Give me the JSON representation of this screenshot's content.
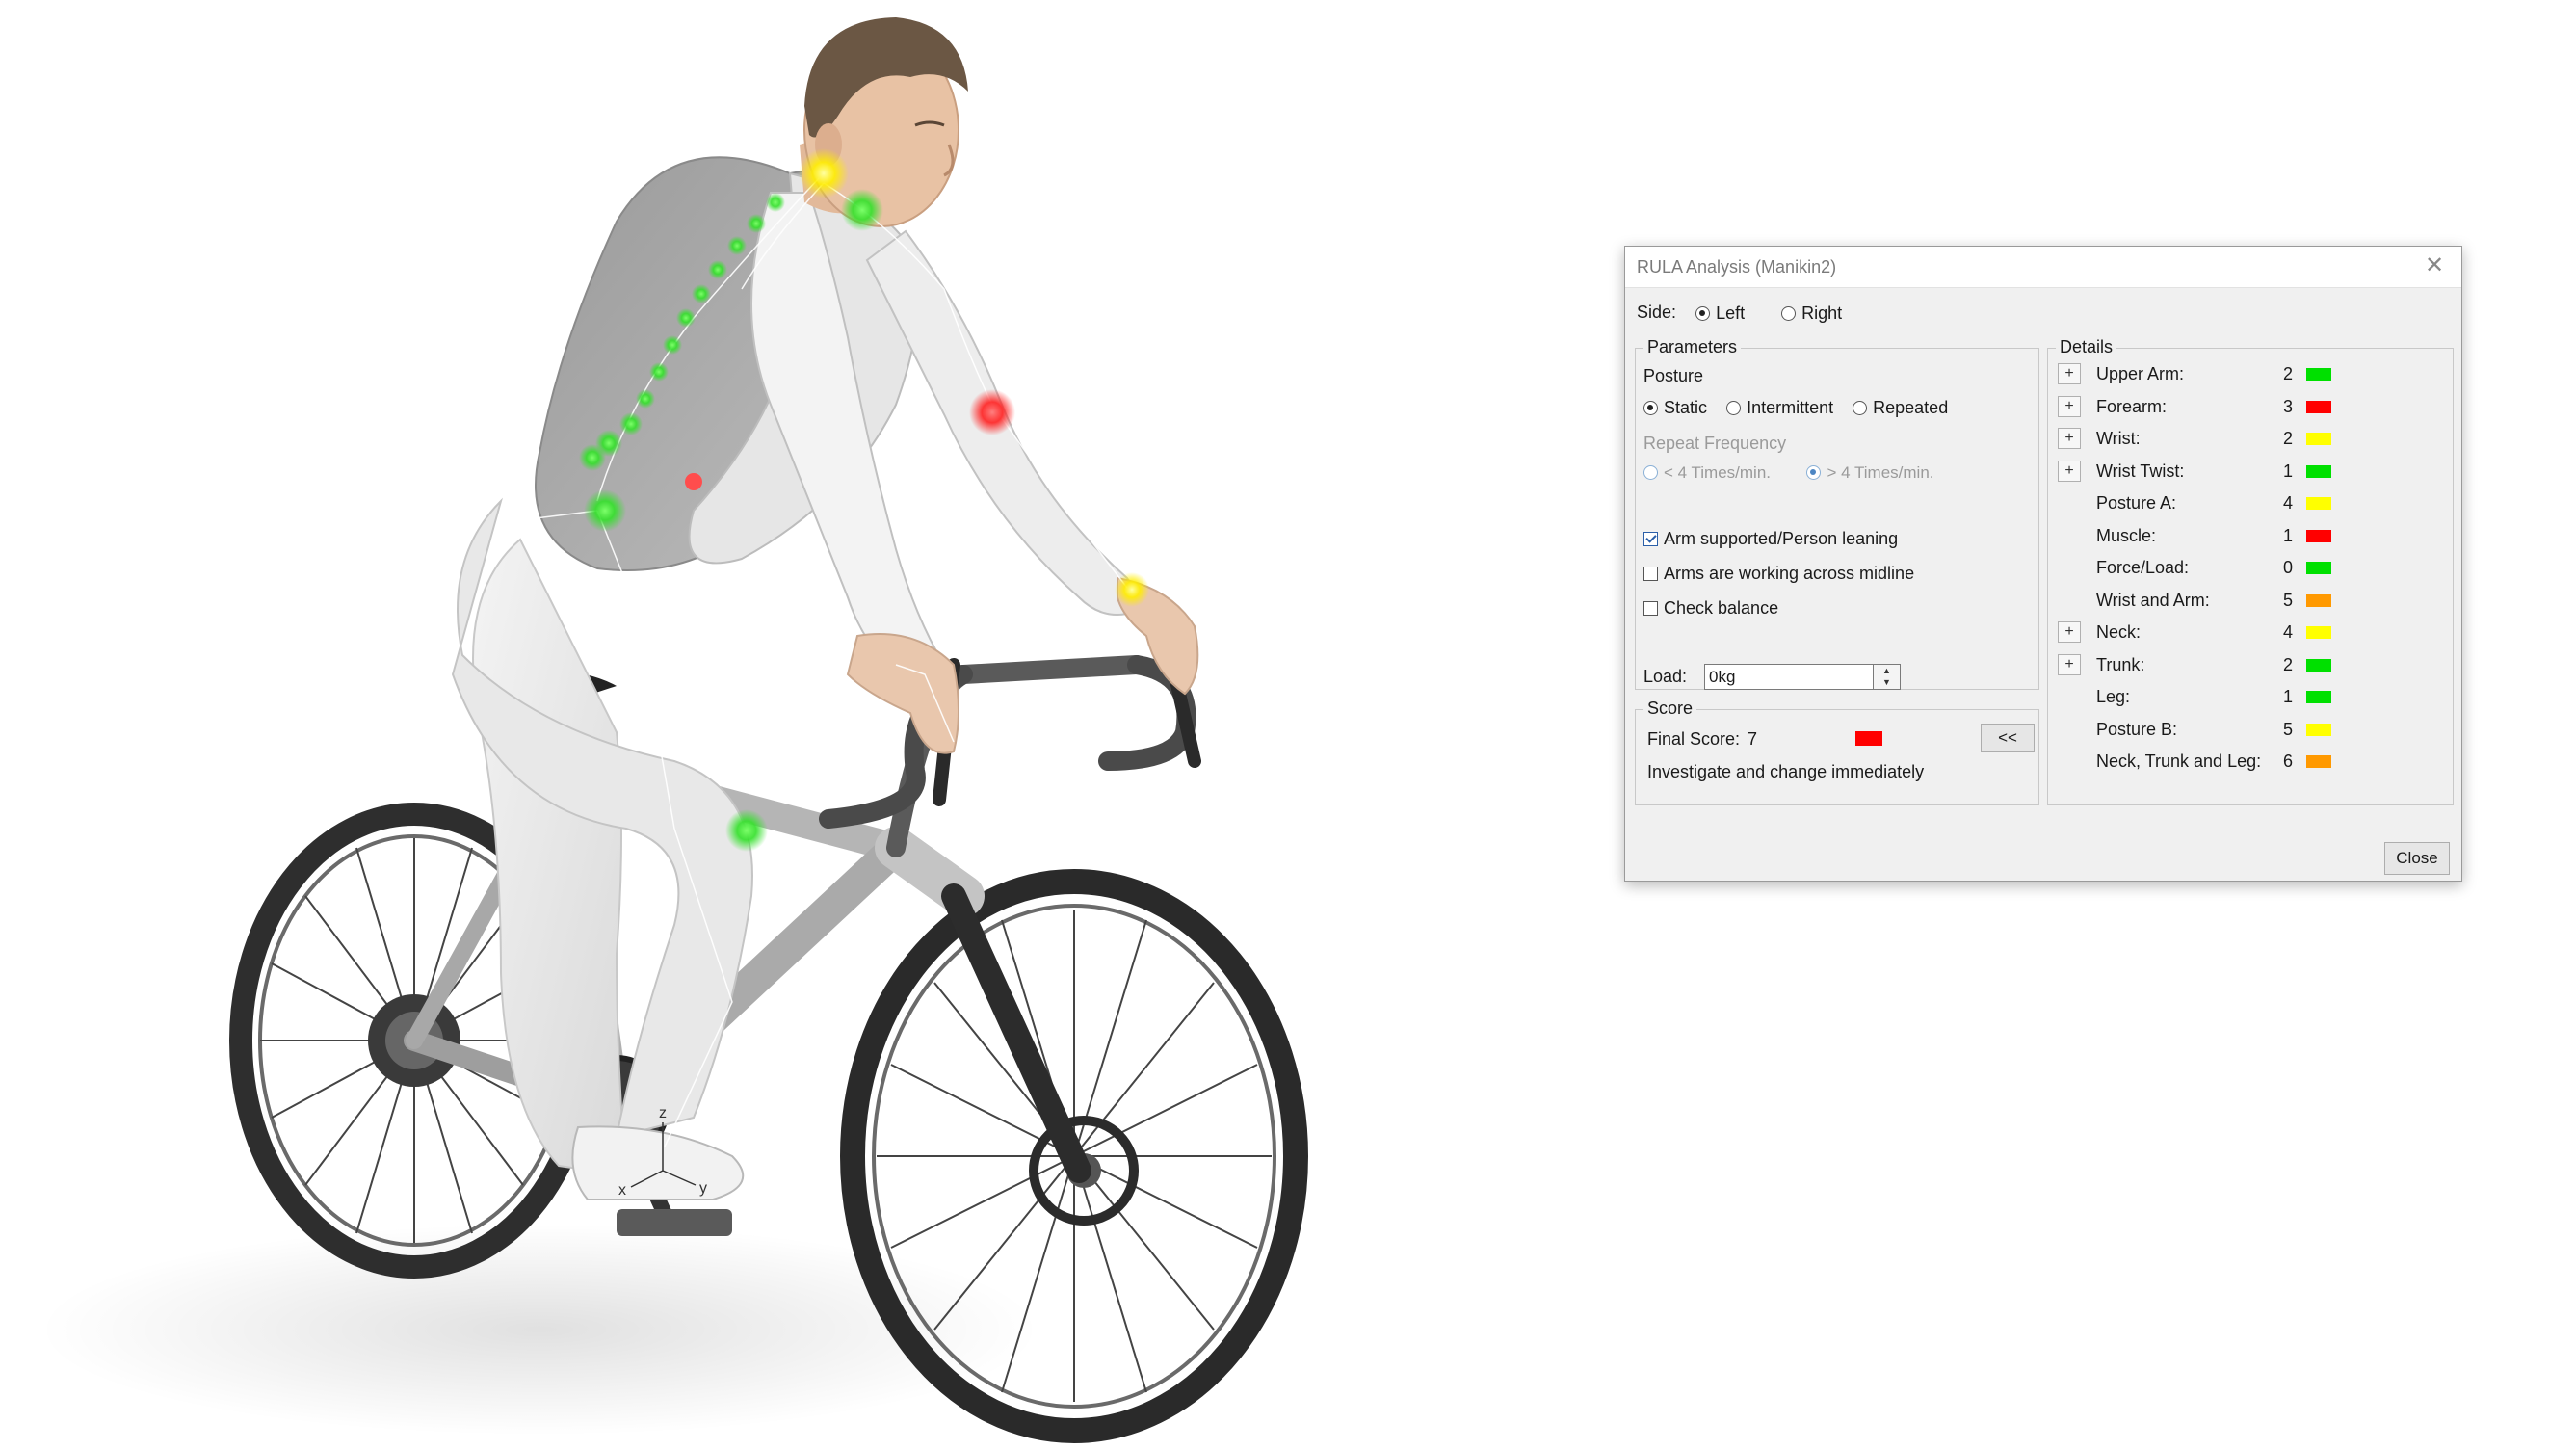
{
  "dialog": {
    "title": "RULA Analysis (Manikin2)",
    "close_glyph": "✕",
    "side": {
      "label": "Side:",
      "options": [
        "Left",
        "Right"
      ],
      "selected": "Left"
    },
    "parameters": {
      "group_title": "Parameters",
      "posture_label": "Posture",
      "posture_options": [
        "Static",
        "Intermittent",
        "Repeated"
      ],
      "posture_selected": "Static",
      "repeat_label": "Repeat Frequency",
      "repeat_options": [
        "< 4 Times/min.",
        "> 4 Times/min."
      ],
      "repeat_selected": "> 4 Times/min.",
      "checks": [
        {
          "label": "Arm supported/Person leaning",
          "checked": true
        },
        {
          "label": "Arms are working across midline",
          "checked": false
        },
        {
          "label": "Check balance",
          "checked": false
        }
      ],
      "load_label": "Load:",
      "load_value": "0kg"
    },
    "score": {
      "group_title": "Score",
      "final_label": "Final Score:",
      "final_value": "7",
      "final_color": "#ff0000",
      "message": "Investigate and change immediately",
      "collapse_button": "<<"
    },
    "details": {
      "group_title": "Details",
      "expand_glyph": "+",
      "rows": [
        {
          "name": "Upper Arm:",
          "value": "2",
          "color": "#00e000",
          "expandable": true
        },
        {
          "name": "Forearm:",
          "value": "3",
          "color": "#ff0000",
          "expandable": true
        },
        {
          "name": "Wrist:",
          "value": "2",
          "color": "#ffff00",
          "expandable": true
        },
        {
          "name": "Wrist Twist:",
          "value": "1",
          "color": "#00e000",
          "expandable": true
        },
        {
          "name": "Posture A:",
          "value": "4",
          "color": "#ffff00",
          "expandable": false
        },
        {
          "name": "Muscle:",
          "value": "1",
          "color": "#ff0000",
          "expandable": false
        },
        {
          "name": "Force/Load:",
          "value": "0",
          "color": "#00e000",
          "expandable": false
        },
        {
          "name": "Wrist and Arm:",
          "value": "5",
          "color": "#ff9900",
          "expandable": false
        },
        {
          "name": "Neck:",
          "value": "4",
          "color": "#ffff00",
          "expandable": true
        },
        {
          "name": "Trunk:",
          "value": "2",
          "color": "#00e000",
          "expandable": true
        },
        {
          "name": "Leg:",
          "value": "1",
          "color": "#00e000",
          "expandable": false
        },
        {
          "name": "Posture B:",
          "value": "5",
          "color": "#ffff00",
          "expandable": false
        },
        {
          "name": "Neck, Trunk and Leg:",
          "value": "6",
          "color": "#ff9900",
          "expandable": false
        }
      ]
    },
    "close_button": "Close"
  },
  "viewport": {
    "axis_labels": [
      "z",
      "x",
      "y"
    ],
    "joint_colors": {
      "ok": "#33e02a",
      "warn": "#ffee00",
      "bad": "#ff2020"
    }
  }
}
